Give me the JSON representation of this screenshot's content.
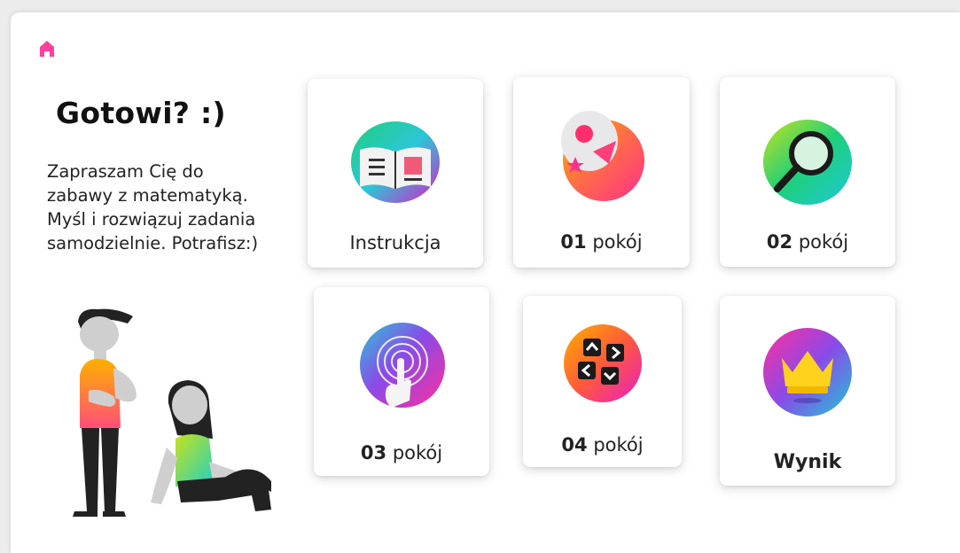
{
  "nav": {
    "home_icon": "home-icon",
    "accent": "#ff3f9c"
  },
  "intro": {
    "title": "Gotowi? :)",
    "text": "Zapraszam Cię do\nzabawy z matematyką.\nMyśl i rozwiązuj zadania\nsamodzielnie. Potrafisz:)"
  },
  "cards": [
    {
      "num": "",
      "label": "Instrukcja",
      "icon": "open-book-icon"
    },
    {
      "num": "01",
      "label": "pokój",
      "icon": "shapes-icon"
    },
    {
      "num": "02",
      "label": "pokój",
      "icon": "magnifier-icon"
    },
    {
      "num": "03",
      "label": "pokój",
      "icon": "touch-icon"
    },
    {
      "num": "04",
      "label": "pokój",
      "icon": "arrow-keys-icon"
    },
    {
      "num": "",
      "label": "Wynik",
      "icon": "crown-icon"
    }
  ]
}
